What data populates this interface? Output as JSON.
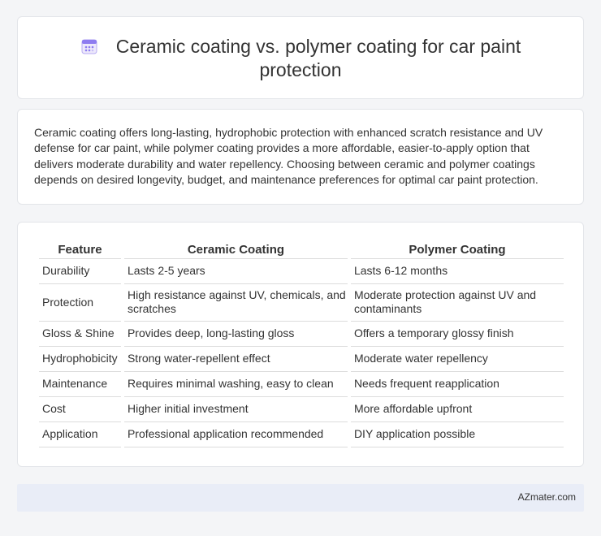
{
  "title": "Ceramic coating vs. polymer coating for car paint protection",
  "title_icon": "calendar-icon",
  "summary": "Ceramic coating offers long-lasting, hydrophobic protection with enhanced scratch resistance and UV defense for car paint, while polymer coating provides a more affordable, easier-to-apply option that delivers moderate durability and water repellency. Choosing between ceramic and polymer coatings depends on desired longevity, budget, and maintenance preferences for optimal car paint protection.",
  "table": {
    "headers": [
      "Feature",
      "Ceramic Coating",
      "Polymer Coating"
    ],
    "rows": [
      [
        "Durability",
        "Lasts 2-5 years",
        "Lasts 6-12 months"
      ],
      [
        "Protection",
        "High resistance against UV, chemicals, and scratches",
        "Moderate protection against UV and contaminants"
      ],
      [
        "Gloss & Shine",
        "Provides deep, long-lasting gloss",
        "Offers a temporary glossy finish"
      ],
      [
        "Hydrophobicity",
        "Strong water-repellent effect",
        "Moderate water repellency"
      ],
      [
        "Maintenance",
        "Requires minimal washing, easy to clean",
        "Needs frequent reapplication"
      ],
      [
        "Cost",
        "Higher initial investment",
        "More affordable upfront"
      ],
      [
        "Application",
        "Professional application recommended",
        "DIY application possible"
      ]
    ]
  },
  "footer": "AZmater.com",
  "colors": {
    "background": "#f4f5f7",
    "card": "#ffffff",
    "footer_bg": "#e9edf7",
    "icon_accent": "#8e7cf0"
  }
}
